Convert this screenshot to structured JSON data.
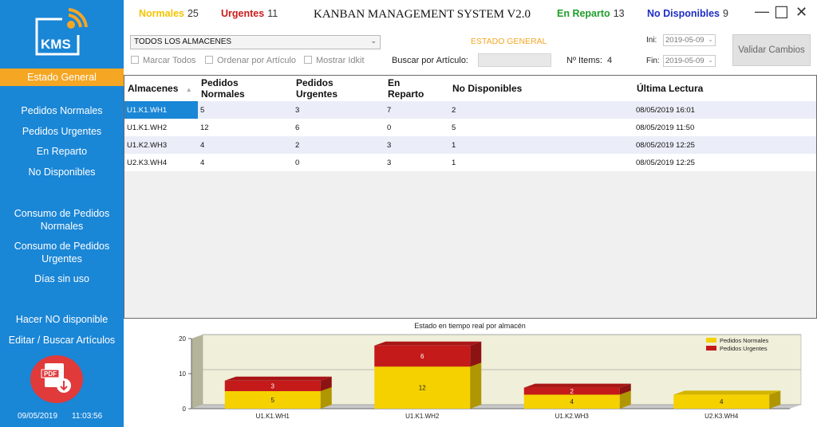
{
  "header": {
    "normales_label": "Normales",
    "normales_count": "25",
    "urgentes_label": "Urgentes",
    "urgentes_count": "11",
    "title": "KANBAN MANAGEMENT SYSTEM V2.0",
    "reparto_label": "En Reparto",
    "reparto_count": "13",
    "nodisp_label": "No Disponibles",
    "nodisp_count": "9"
  },
  "window": {
    "minimize": "—",
    "maximize": "☐",
    "close": "✕"
  },
  "sidebar": {
    "logo_text": "KMS",
    "active": "Estado General",
    "items": [
      "Pedidos Normales",
      "Pedidos Urgentes",
      "En Reparto",
      "No Disponibles",
      "Consumo de Pedidos Normales",
      "Consumo de Pedidos Urgentes",
      "Días sin uso",
      "Hacer NO disponible",
      "Editar / Buscar Artículos"
    ],
    "pdf_label": "PDF",
    "date": "09/05/2019",
    "time": "11:03:56"
  },
  "filters": {
    "warehouse_select": "TODOS LOS ALMACENES",
    "estado_general": "ESTADO GENERAL",
    "ini_label": "Ini:",
    "ini_value": "2019-05-09",
    "fin_label": "Fin:",
    "fin_value": "2019-05-09",
    "validar": "Validar Cambios",
    "marcar_todos": "Marcar Todos",
    "ordenar": "Ordenar por Artículo",
    "mostrar": "Mostrar Idkit",
    "buscar_label": "Buscar por Artículo:",
    "buscar_value": "",
    "nitems_label": "Nº Items:",
    "nitems_value": "4"
  },
  "table": {
    "headers": [
      "Almacenes",
      "Pedidos\nNormales",
      "Pedidos\nUrgentes",
      "En\nReparto",
      "No Disponibles",
      "Última Lectura"
    ],
    "sort_indicator": "▲",
    "rows": [
      [
        "U1.K1.WH1",
        "5",
        "3",
        "7",
        "2",
        "08/05/2019 16:01"
      ],
      [
        "U1.K1.WH2",
        "12",
        "6",
        "0",
        "5",
        "08/05/2019 11:50"
      ],
      [
        "U1.K2.WH3",
        "4",
        "2",
        "3",
        "1",
        "08/05/2019 12:25"
      ],
      [
        "U2.K3.WH4",
        "4",
        "0",
        "3",
        "1",
        "08/05/2019 12:25"
      ]
    ]
  },
  "colors": {
    "sidebar": "#1a86d6",
    "active": "#f5a623",
    "normales": "#f5c400",
    "urgentes": "#cc1b1b",
    "reparto": "#1e9e2a",
    "nodisp": "#1e2ec4"
  },
  "chart_data": {
    "type": "bar",
    "title": "Estado en tiempo real por almacén",
    "categories": [
      "U1.K1.WH1",
      "U1.K1.WH2",
      "U1.K2.WH3",
      "U2.K3.WH4"
    ],
    "series": [
      {
        "name": "Pedidos Normales",
        "values": [
          5,
          12,
          4,
          4
        ],
        "color": "#f5d100"
      },
      {
        "name": "Pedidos Urgentes",
        "values": [
          3,
          6,
          2,
          0
        ],
        "color": "#c41a1a"
      }
    ],
    "stacked": true,
    "yticks": [
      0,
      10,
      20
    ],
    "ylim": [
      0,
      20
    ],
    "legend": "top-right",
    "grid": true
  }
}
